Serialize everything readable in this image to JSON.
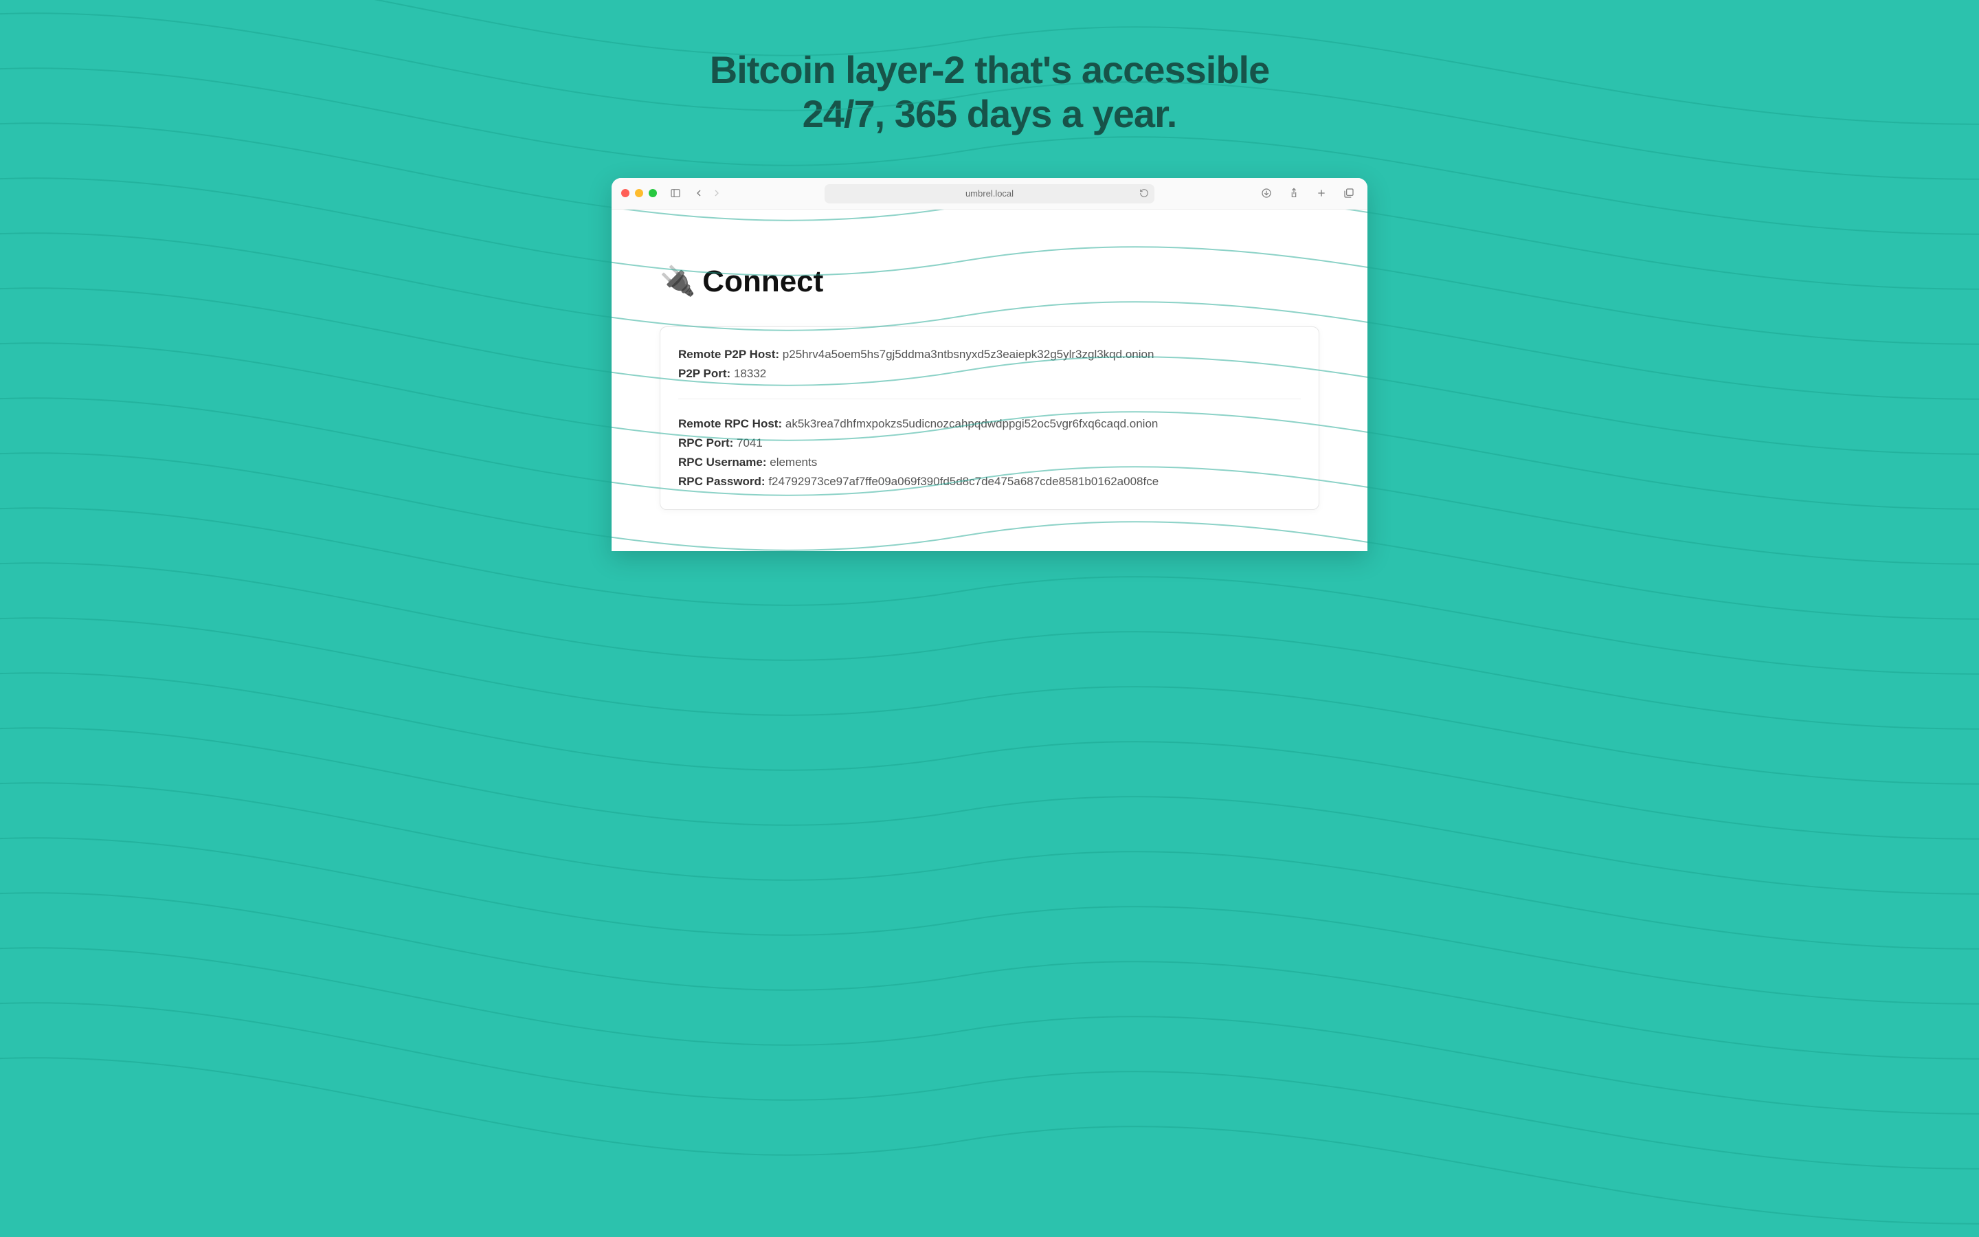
{
  "hero": {
    "line1": "Bitcoin layer-2 that's accessible",
    "line2": "24/7, 365 days a year."
  },
  "browser": {
    "url": "umbrel.local"
  },
  "page": {
    "title": "Connect",
    "icon": "🔌"
  },
  "connect": {
    "p2p_host_label": "Remote P2P Host:",
    "p2p_host_value": "p25hrv4a5oem5hs7gj5ddma3ntbsnyxd5z3eaiepk32g5ylr3zgl3kqd.onion",
    "p2p_port_label": "P2P Port:",
    "p2p_port_value": "18332",
    "rpc_host_label": "Remote RPC Host:",
    "rpc_host_value": "ak5k3rea7dhfmxpokzs5udicnozcahpqdwdppgi52oc5vgr6fxq6caqd.onion",
    "rpc_port_label": "RPC Port:",
    "rpc_port_value": "7041",
    "rpc_user_label": "RPC Username:",
    "rpc_user_value": "elements",
    "rpc_pass_label": "RPC Password:",
    "rpc_pass_value": "f24792973ce97af7ffe09a069f390fd5d8c7de475a687cde8581b0162a008fce"
  },
  "colors": {
    "bg": "#2cc2ad",
    "heroText": "#175349"
  }
}
